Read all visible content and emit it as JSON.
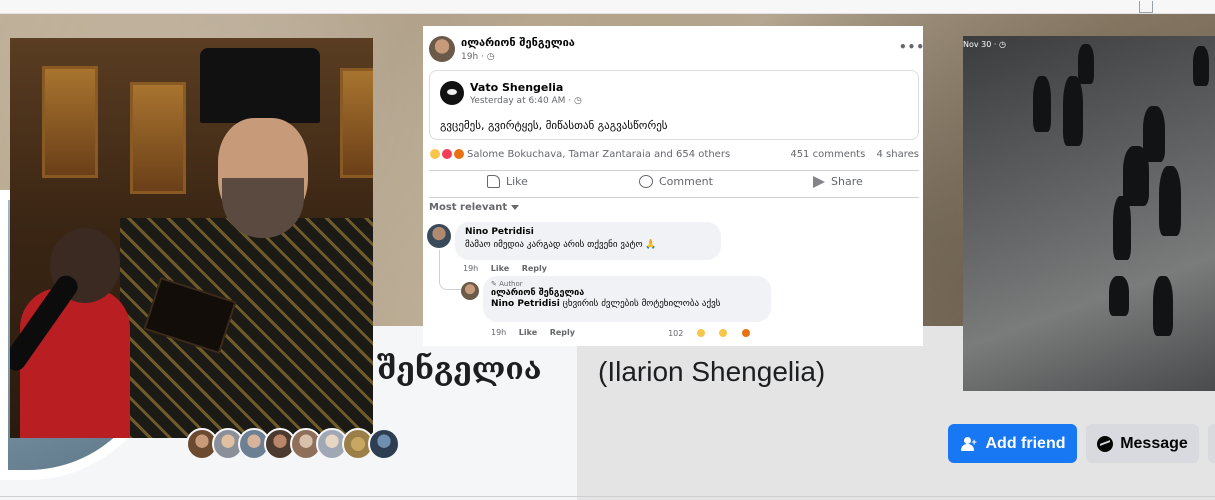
{
  "post": {
    "author": "ილარიონ შენგელია",
    "meta": "19h · ◷",
    "more": "•••",
    "shared": {
      "name": "Vato Shengelia",
      "meta": "Yesterday at 6:40 AM · ◷",
      "text": "გვცემეს, გვირტყეს, მიწასთან გაგვასწორეს"
    },
    "reactions": {
      "names": "Salome Bokuchava, Tamar Zantaraia and 654 others",
      "comments": "451 comments",
      "shares": "4 shares"
    },
    "actions": {
      "like": "Like",
      "comment": "Comment",
      "share": "Share"
    },
    "sort_label": "Most relevant",
    "comments": [
      {
        "name": "Nino Petridisi",
        "text": "მამაო იმედია კარგად არის თქვენი ვატო 🙏",
        "time": "19h",
        "like": "Like",
        "reply": "Reply"
      }
    ],
    "reply": {
      "badge": "✎ Author",
      "name": "ილარიონ შენგელია",
      "mention": "Nino Petridisi",
      "text": "ცხვირის ძვლების მოტეხილობა აქვს",
      "time": "19h",
      "like": "Like",
      "reply": "Reply",
      "count": "102"
    }
  },
  "video": {
    "label": "Nov 30 · ◷"
  },
  "profile": {
    "name_ka": "შენგელია",
    "name_en": "(Ilarion Shengelia)"
  },
  "buttons": {
    "add_friend": "Add friend",
    "message": "Message"
  },
  "colors": {
    "primary": "#1877f2",
    "secondary": "#d8dadf"
  }
}
